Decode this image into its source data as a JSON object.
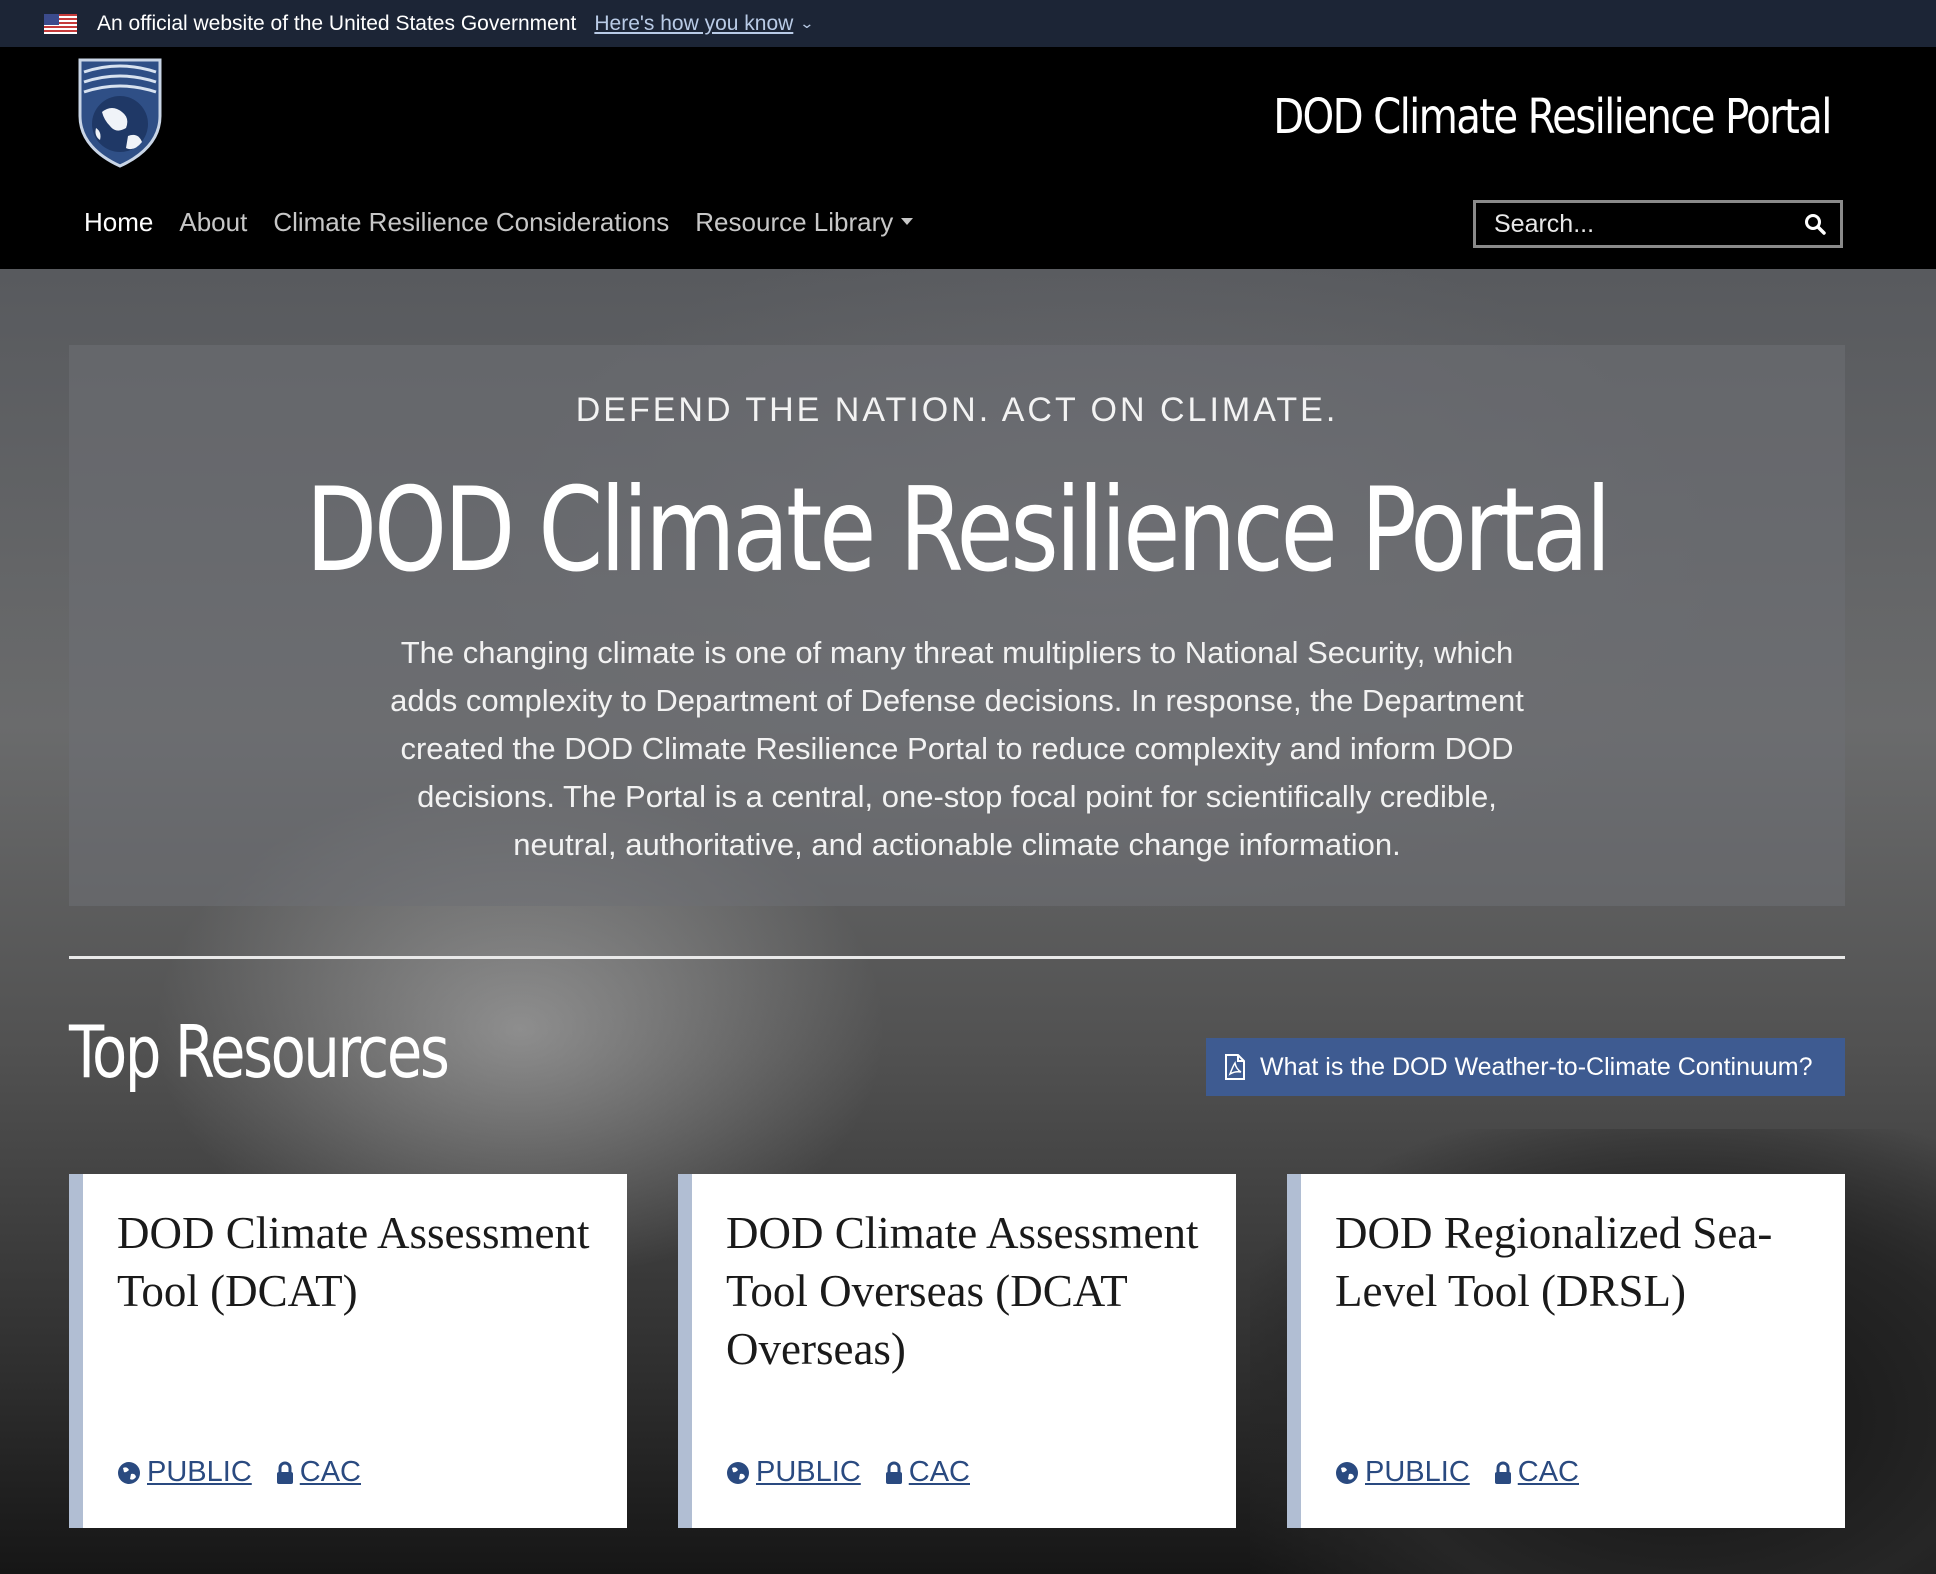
{
  "gov_banner": {
    "text": "An official website of the United States Government",
    "link": "Here's how you know"
  },
  "header": {
    "site_title": "DOD Climate Resilience Portal",
    "nav": [
      "Home",
      "About",
      "Climate Resilience Considerations",
      "Resource Library"
    ],
    "search_placeholder": "Search..."
  },
  "hero": {
    "tagline": "DEFEND THE NATION. ACT ON CLIMATE.",
    "title": "DOD Climate Resilience Portal",
    "description": "The changing climate is one of many threat multipliers to National Security, which adds complexity to Department of Defense decisions. In response, the Department created the DOD Climate Resilience Portal to reduce complexity and inform DOD decisions. The Portal is a central, one-stop focal point for scientifically credible, neutral, authoritative, and actionable climate change information."
  },
  "top_resources": {
    "title": "Top Resources",
    "button": "What is the DOD Weather-to-Climate Continuum?",
    "cards": [
      {
        "title": "DOD Climate Assessment Tool (DCAT)",
        "public": "PUBLIC",
        "cac": "CAC"
      },
      {
        "title": "DOD Climate Assessment Tool Overseas (DCAT Overseas)",
        "public": "PUBLIC",
        "cac": "CAC"
      },
      {
        "title": "DOD Regionalized Sea-Level Tool (DRSL)",
        "public": "PUBLIC",
        "cac": "CAC"
      }
    ]
  },
  "colors": {
    "button": "#3e5b91",
    "link": "#2a4a80",
    "card_accent": "#b1bed3"
  },
  "icons": [
    "us-flag-icon",
    "chevron-down-icon",
    "search-icon",
    "pdf-icon",
    "globe-icon",
    "lock-icon"
  ]
}
